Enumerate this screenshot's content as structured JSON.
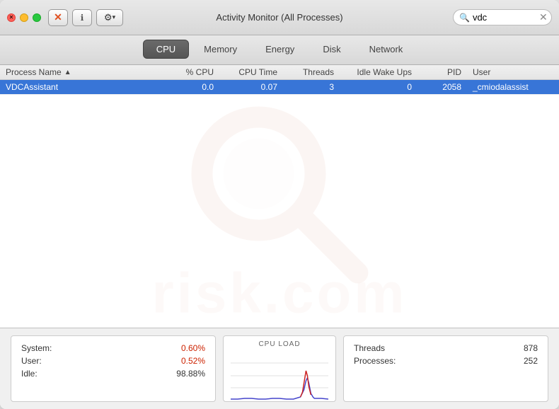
{
  "window": {
    "title": "Activity Monitor (All Processes)"
  },
  "toolbar": {
    "close_label": "×",
    "minimize_label": "–",
    "maximize_label": "+",
    "stop_btn": "✕",
    "info_btn": "ℹ",
    "gear_btn": "⚙ ▾"
  },
  "tabs": [
    {
      "id": "cpu",
      "label": "CPU",
      "active": true
    },
    {
      "id": "memory",
      "label": "Memory",
      "active": false
    },
    {
      "id": "energy",
      "label": "Energy",
      "active": false
    },
    {
      "id": "disk",
      "label": "Disk",
      "active": false
    },
    {
      "id": "network",
      "label": "Network",
      "active": false
    }
  ],
  "search": {
    "placeholder": "Search",
    "value": "vdc"
  },
  "columns": [
    {
      "id": "process-name",
      "label": "Process Name",
      "sortable": true
    },
    {
      "id": "pct-cpu",
      "label": "% CPU"
    },
    {
      "id": "cpu-time",
      "label": "CPU Time"
    },
    {
      "id": "threads",
      "label": "Threads"
    },
    {
      "id": "idle-wake",
      "label": "Idle Wake Ups"
    },
    {
      "id": "pid",
      "label": "PID"
    },
    {
      "id": "user",
      "label": "User"
    }
  ],
  "processes": [
    {
      "name": "VDCAssistant",
      "pct_cpu": "0.0",
      "cpu_time": "0.07",
      "threads": "3",
      "idle_wake": "0",
      "pid": "2058",
      "user": "_cmiodalassist",
      "selected": true
    }
  ],
  "stats": {
    "system_label": "System:",
    "system_value": "0.60%",
    "user_label": "User:",
    "user_value": "0.52%",
    "idle_label": "Idle:",
    "idle_value": "98.88%",
    "cpu_load_title": "CPU LOAD",
    "threads_label": "Threads",
    "threads_value": "878",
    "processes_label": "Processes:",
    "processes_value": "252"
  }
}
